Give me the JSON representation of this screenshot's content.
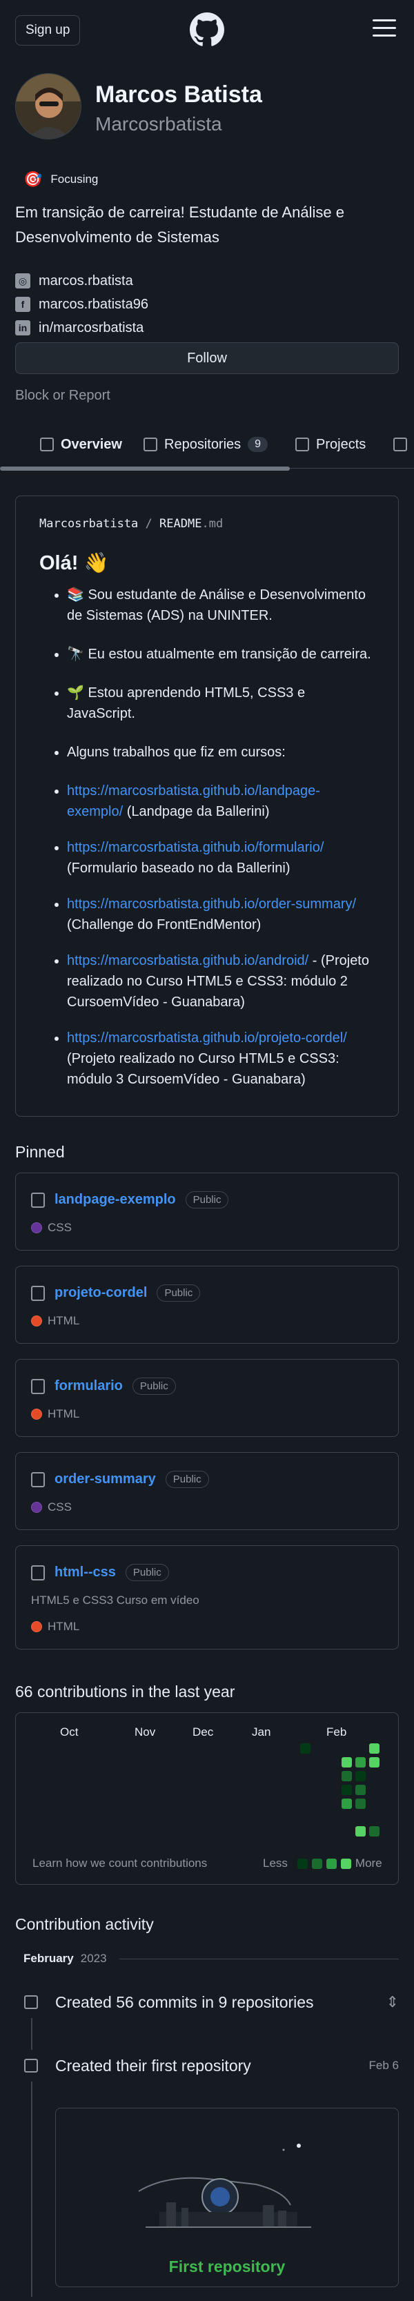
{
  "header": {
    "signup_label": "Sign up",
    "logo_icon": "github-mark-icon",
    "menu_icon": "hamburger-menu-icon"
  },
  "profile": {
    "full_name": "Marcos Batista",
    "username": "Marcosrbatista",
    "status_emoji": "🎯",
    "status_text": "Focusing",
    "bio": "Em transição de carreira! Estudante de Análise e Desenvolvimento de Sistemas",
    "links": [
      {
        "icon": "instagram-icon",
        "text": "marcos.rbatista"
      },
      {
        "icon": "facebook-icon",
        "text": "marcos.rbatista96"
      },
      {
        "icon": "linkedin-icon",
        "text": "in/marcosrbatista"
      }
    ],
    "follow_label": "Follow",
    "block_report": "Block or Report"
  },
  "tabs": [
    {
      "label": "Overview",
      "icon": "book-icon",
      "active": true
    },
    {
      "label": "Repositories",
      "icon": "repo-icon",
      "count": "9"
    },
    {
      "label": "Projects",
      "icon": "table-icon"
    },
    {
      "label": "",
      "icon": "package-icon"
    }
  ],
  "readme": {
    "owner": "Marcosrbatista",
    "separator": "/",
    "file": "README",
    "ext": ".md",
    "heading": "Olá! 👋",
    "items": [
      {
        "text": "📚 Sou estudante de Análise e Desenvolvimento de Sistemas (ADS) na UNINTER."
      },
      {
        "text": "🔭 Eu estou atualmente em transição de carreira."
      },
      {
        "text": "🌱 Estou aprendendo HTML5, CSS3 e JavaScript."
      },
      {
        "text": "Alguns trabalhos que fiz em cursos:"
      },
      {
        "link": "https://marcosrbatista.github.io/landpage-exemplo/",
        "text": " (Landpage da Ballerini)"
      },
      {
        "link": "https://marcosrbatista.github.io/formulario/",
        "text": " (Formulario baseado no da Ballerini)"
      },
      {
        "link": "https://marcosrbatista.github.io/order-summary/",
        "text": " (Challenge do FrontEndMentor)"
      },
      {
        "link": "https://marcosrbatista.github.io/android/",
        "text": " - (Projeto realizado no Curso HTML5 e CSS3: módulo 2 CursoemVídeo - Guanabara)"
      },
      {
        "link": "https://marcosrbatista.github.io/projeto-cordel/",
        "text": " (Projeto realizado no Curso HTML5 e CSS3: módulo 3 CursoemVídeo - Guanabara)"
      }
    ]
  },
  "pinned": {
    "title": "Pinned",
    "repos": [
      {
        "name": "landpage-exemplo",
        "visibility": "Public",
        "description": "",
        "language": "CSS",
        "lang_color": "#663399"
      },
      {
        "name": "projeto-cordel",
        "visibility": "Public",
        "description": "",
        "language": "HTML",
        "lang_color": "#e34c26"
      },
      {
        "name": "formulario",
        "visibility": "Public",
        "description": "",
        "language": "HTML",
        "lang_color": "#e34c26"
      },
      {
        "name": "order-summary",
        "visibility": "Public",
        "description": "",
        "language": "CSS",
        "lang_color": "#663399"
      },
      {
        "name": "html--css",
        "visibility": "Public",
        "description": "HTML5 e CSS3 Curso em vídeo",
        "language": "HTML",
        "lang_color": "#e34c26"
      }
    ]
  },
  "contributions": {
    "title": "66 contributions in the last year",
    "months": [
      "Oct",
      "Nov",
      "Dec",
      "Jan",
      "Feb"
    ],
    "learn_link": "Learn how we count contributions",
    "less_label": "Less",
    "more_label": "More",
    "level_colors": [
      "#161b22",
      "#033a16",
      "#196c2e",
      "#2ea043",
      "#56d364"
    ]
  },
  "activity": {
    "title": "Contribution activity",
    "month": "February",
    "year": "2023",
    "events": [
      {
        "icon": "repo-push-icon",
        "text": "Created 56 commits in 9 repositories",
        "date": ""
      },
      {
        "icon": "repo-icon",
        "text": "Created their first repository",
        "date": "Feb 6"
      }
    ],
    "first_repo_label": "First repository"
  }
}
